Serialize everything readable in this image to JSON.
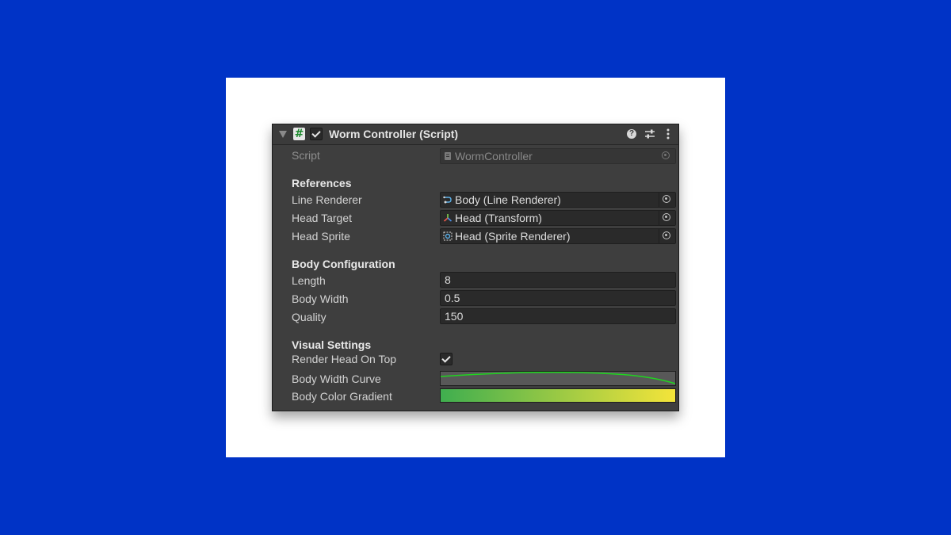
{
  "component": {
    "title": "Worm Controller (Script)",
    "enabled": true,
    "header_icons": [
      "hash-script-icon",
      "help-icon",
      "preset-icon",
      "kebab-menu-icon"
    ]
  },
  "script_row": {
    "label": "Script",
    "value": "WormController"
  },
  "sections": {
    "references": "References",
    "body_configuration": "Body Configuration",
    "visual_settings": "Visual Settings"
  },
  "references": [
    {
      "label": "Line Renderer",
      "value": "Body (Line Renderer)",
      "icon": "line-renderer-icon"
    },
    {
      "label": "Head Target",
      "value": "Head (Transform)",
      "icon": "transform-icon"
    },
    {
      "label": "Head Sprite",
      "value": "Head (Sprite Renderer)",
      "icon": "sprite-renderer-icon"
    }
  ],
  "body_configuration": [
    {
      "label": "Length",
      "value": "8"
    },
    {
      "label": "Body Width",
      "value": "0.5"
    },
    {
      "label": "Quality",
      "value": "150"
    }
  ],
  "visual_settings": {
    "render_head_on_top": {
      "label": "Render Head On Top",
      "checked": true
    },
    "body_width_curve": {
      "label": "Body Width Curve",
      "curve_color": "#1fd41f"
    },
    "body_color_gradient": {
      "label": "Body Color Gradient",
      "start_color": "#3fae4f",
      "end_color": "#f4e43a"
    }
  },
  "colors": {
    "background": "#0033c6",
    "card": "#ffffff",
    "inspector": "#3e3e3e"
  }
}
